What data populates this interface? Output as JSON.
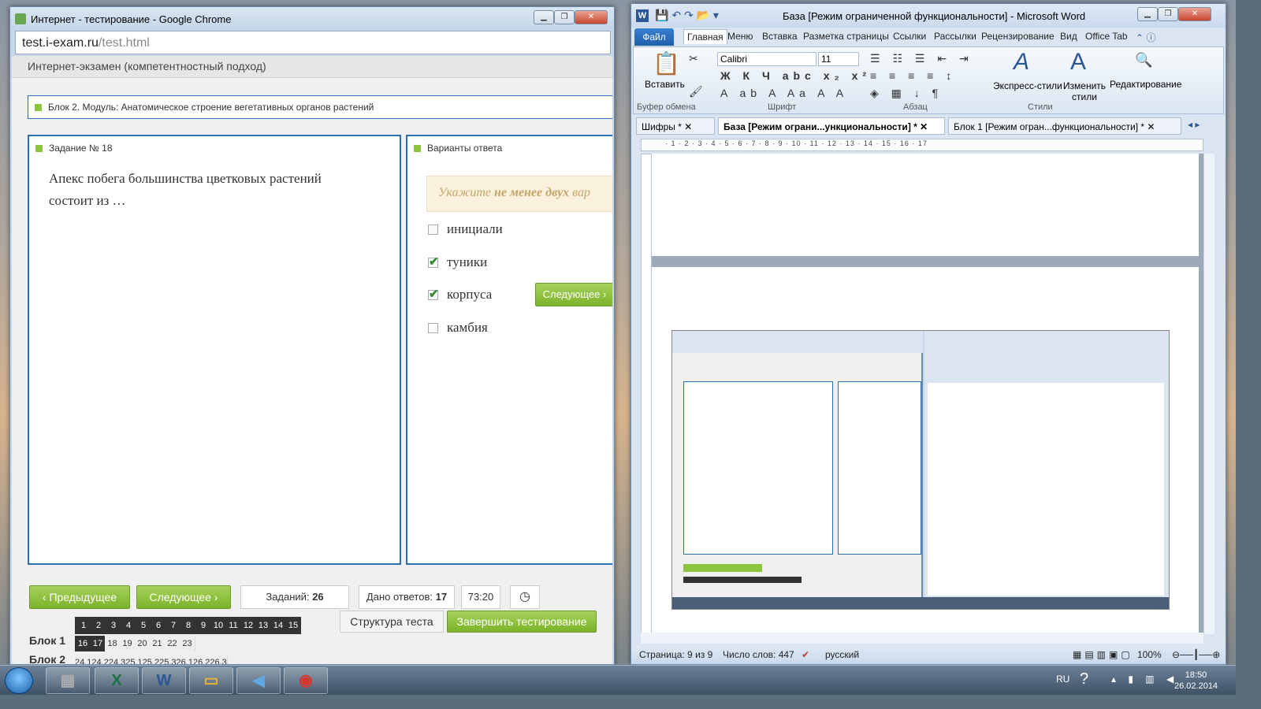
{
  "chrome": {
    "title": "Интернет - тестирование - Google Chrome",
    "url_domain": "test.i-exam.ru",
    "url_path": "/test.html",
    "header": "Интернет-экзамен (компетентностный подход)",
    "block_title": "Блок 2. Модуль: Анатомическое строение вегетативных органов растений",
    "task_label": "Задание № 18",
    "question": "Апекс побега большинства цветковых растений состоит из …",
    "answers_label": "Варианты ответа",
    "hint_prefix": "Укажите ",
    "hint_bold": "не менее двух",
    "hint_suffix": " вар",
    "options": [
      {
        "text": "инициали",
        "checked": false
      },
      {
        "text": "туники",
        "checked": true
      },
      {
        "text": "корпуса",
        "checked": true
      },
      {
        "text": "камбия",
        "checked": false
      }
    ],
    "next_inline": "Следующее",
    "prev_btn": "Предыдущее",
    "next_btn": "Следующее",
    "tasks_label": "Заданий:",
    "tasks_count": "26",
    "answered_label": "Дано ответов:",
    "answered_count": "17",
    "timer": "73:20",
    "structure_btn": "Структура теста",
    "finish_btn": "Завершить тестирование",
    "block1_label": "Блок 1",
    "block2_label": "Блок 2",
    "row_top": [
      "1",
      "2",
      "3",
      "4",
      "5",
      "6",
      "7",
      "8",
      "9",
      "10",
      "11",
      "12",
      "13",
      "14",
      "15"
    ],
    "row_block1": [
      "16",
      "17",
      "18",
      "19",
      "20",
      "21",
      "22",
      "23"
    ],
    "row_block2": [
      "24.1",
      "24.2",
      "24.3",
      "25.1",
      "25.2",
      "25.3",
      "26.1",
      "26.2",
      "26.3"
    ]
  },
  "word": {
    "title": "База [Режим ограниченной функциональности] - Microsoft Word",
    "tabs": [
      "Файл",
      "Главная",
      "Меню",
      "Вставка",
      "Разметка страницы",
      "Ссылки",
      "Рассылки",
      "Рецензирование",
      "Вид",
      "Office Tab"
    ],
    "paste": "Вставить",
    "font": "Calibri",
    "size": "11",
    "groups": [
      "Буфер обмена",
      "Шрифт",
      "Абзац",
      "Стили"
    ],
    "express_styles": "Экспресс-стили",
    "change_styles": "Изменить стили",
    "editing": "Редактирование",
    "doc_tabs": [
      "Шифры *",
      "База [Режим ограни...ункциональности] *",
      "Блок 1 [Режим огран...функциональности] *"
    ],
    "status_page": "Страница: 9 из 9",
    "status_words": "Число слов: 447",
    "status_lang": "русский",
    "zoom": "100%"
  },
  "taskbar": {
    "lang": "RU",
    "time": "18:50",
    "date": "26.02.2014"
  }
}
